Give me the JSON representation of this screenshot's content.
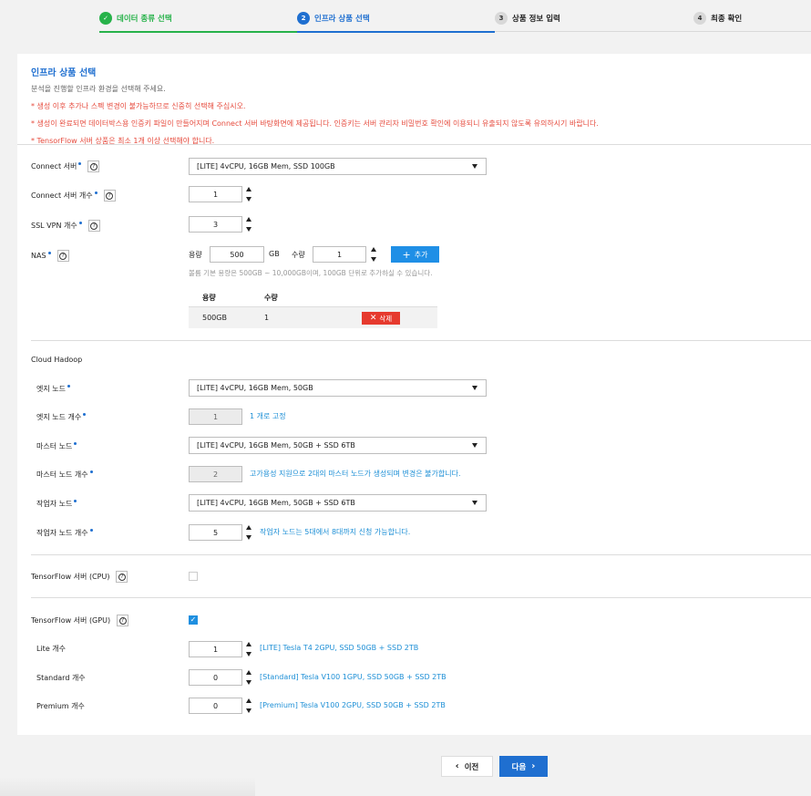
{
  "steps": [
    {
      "number": "✓",
      "label": "데이터 종류 선택"
    },
    {
      "number": "2",
      "label": "인프라 상품 선택"
    },
    {
      "number": "3",
      "label": "상품 정보 입력"
    },
    {
      "number": "4",
      "label": "최종 확인"
    }
  ],
  "header": {
    "title": "인프라 상품 선택",
    "description": "분석을 진행할 인프라 환경을 선택해 주세요.",
    "warnings": [
      "* 생성 이후 추가나 스펙 변경이 불가능하므로 신중히 선택해 주십시오.",
      "* 생성이 완료되면 데이터박스용 인증키 파일이 만들어지며 Connect 서버 바탕화면에 제공됩니다. 인증키는 서버 관리자 비밀번호 확인에 이용되니 유출되지 않도록 유의하시기 바랍니다.",
      "* TensorFlow 서버 상품은 최소 1개 이상 선택해야 합니다."
    ]
  },
  "connect": {
    "server_label": "Connect 서버",
    "server_value": "[LITE] 4vCPU, 16GB Mem, SSD 100GB",
    "count_label": "Connect 서버 개수",
    "count_value": "1"
  },
  "ssl": {
    "label": "SSL VPN 개수",
    "value": "3"
  },
  "nas": {
    "label": "NAS",
    "capacity_label": "용량",
    "capacity_value": "500",
    "unit": "GB",
    "qty_label": "수량",
    "qty_value": "1",
    "add_label": "추가",
    "hint": "볼륨 기본 용량은 500GB ~ 10,000GB이며, 100GB 단위로 추가하실 수 있습니다.",
    "table_headers": [
      "용량",
      "수량"
    ],
    "rows": [
      {
        "capacity": "500GB",
        "qty": "1",
        "delete_label": "삭제"
      }
    ]
  },
  "hadoop": {
    "section_label": "Cloud Hadoop",
    "edge_label": "엣지 노드",
    "edge_value": "[LITE] 4vCPU, 16GB Mem, 50GB",
    "edge_count_label": "엣지 노드 개수",
    "edge_count_value": "1",
    "edge_count_note": "1 개로 고정",
    "master_label": "마스터 노드",
    "master_value": "[LITE] 4vCPU, 16GB Mem, 50GB + SSD 6TB",
    "master_count_label": "마스터 노드 개수",
    "master_count_value": "2",
    "master_count_note": "고가용성 지원으로 2대의 마스터 노드가 생성되며 변경은 불가합니다.",
    "worker_label": "작업자 노드",
    "worker_value": "[LITE] 4vCPU, 16GB Mem, 50GB + SSD 6TB",
    "worker_count_label": "작업자 노드 개수",
    "worker_count_value": "5",
    "worker_count_note": "작업자 노드는 5대에서 8대까지 신청 가능합니다."
  },
  "tf_cpu": {
    "label": "TensorFlow 서버 (CPU)",
    "checked": false
  },
  "tf_gpu": {
    "label": "TensorFlow 서버 (GPU)",
    "checked": true,
    "lite_label": "Lite 개수",
    "lite_value": "1",
    "lite_note": "[LITE] Tesla T4 2GPU, SSD 50GB + SSD 2TB",
    "standard_label": "Standard 개수",
    "standard_value": "0",
    "standard_note": "[Standard] Tesla V100 1GPU, SSD 50GB + SSD 2TB",
    "premium_label": "Premium 개수",
    "premium_value": "0",
    "premium_note": "[Premium] Tesla V100 2GPU, SSD 50GB + SSD 2TB"
  },
  "nav": {
    "prev_label": "이전",
    "next_label": "다음"
  },
  "colors": {
    "accent": "#1f6fd0",
    "done": "#27b24a",
    "warn": "#e64a3c",
    "note": "#1d8fd6",
    "delete": "#e63a2e"
  }
}
